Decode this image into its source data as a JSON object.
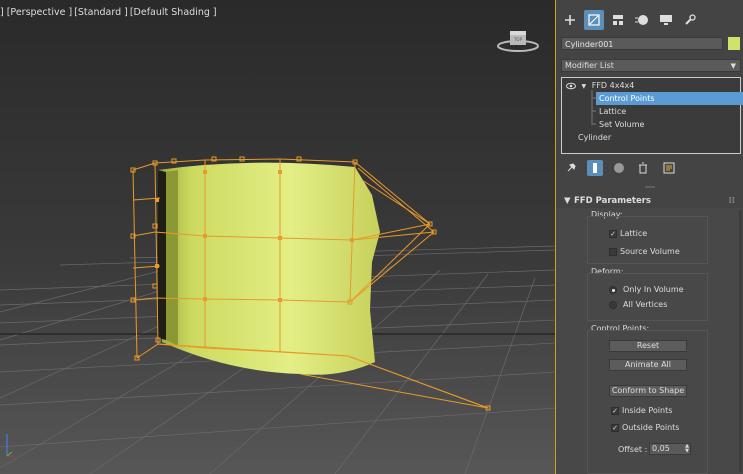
{
  "viewport": {
    "labels": [
      "] [Perspective ]",
      "[Standard ]",
      "[Default Shading ]"
    ],
    "cube_label": "TOP"
  },
  "panel": {
    "tabs": [
      "create-tab",
      "modify-tab",
      "hierarchy-tab",
      "motion-tab",
      "display-tab",
      "utilities-tab"
    ],
    "object_name": "Cylinder001",
    "object_color": "#cfe36a",
    "modifier_list": "Modifier List",
    "stack": {
      "modifier": "FFD 4x4x4",
      "sub_items": [
        "Control Points",
        "Lattice",
        "Set Volume"
      ],
      "selected_sub": "Control Points",
      "base": "Cylinder"
    },
    "rollout": {
      "title": "FFD Parameters",
      "display_label": "Display:",
      "lattice": "Lattice",
      "source_volume": "Source Volume",
      "deform_label": "Deform:",
      "only_in_volume": "Only In Volume",
      "all_vertices": "All Vertices",
      "control_points_label": "Control Points:",
      "reset": "Reset",
      "animate_all": "Animate All",
      "conform": "Conform to Shape",
      "inside_points": "Inside Points",
      "outside_points": "Outside Points",
      "offset_label": "Offset :",
      "offset_value": "0,05"
    },
    "check_mark": "✓",
    "lattice_checked": true,
    "source_volume_checked": false,
    "inside_checked": true,
    "outside_checked": true,
    "deform_mode": "Only In Volume"
  },
  "colors": {
    "accent": "#5b9bd5",
    "lattice": "#e89a2a",
    "mesh": "#d8e56d",
    "viewport_border": "#c9a227"
  }
}
